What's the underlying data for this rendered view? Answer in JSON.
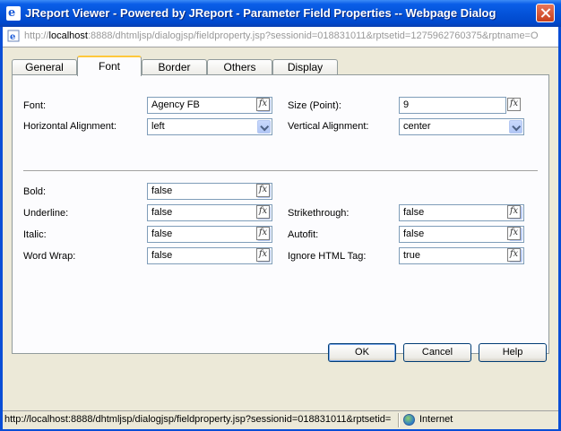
{
  "window": {
    "title": "JReport Viewer - Powered by JReport - Parameter Field Properties -- Webpage Dialog",
    "close_icon": "close-icon"
  },
  "address": {
    "prefix": "http://",
    "host": "localhost",
    "rest": ":8888/dhtmljsp/dialogjsp/fieldproperty.jsp?sessionid=018831011&rptsetid=1275962760375&rptname=O"
  },
  "tabs": [
    "General",
    "Font",
    "Border",
    "Others",
    "Display"
  ],
  "active_tab": "Font",
  "fields": {
    "font": {
      "label": "Font:",
      "value": "Agency FB"
    },
    "size": {
      "label": "Size (Point):",
      "value": "9"
    },
    "halign": {
      "label": "Horizontal Alignment:",
      "value": "left"
    },
    "valign": {
      "label": "Vertical Alignment:",
      "value": "center"
    },
    "bold": {
      "label": "Bold:",
      "value": "false"
    },
    "underline": {
      "label": "Underline:",
      "value": "false"
    },
    "strikethrough": {
      "label": "Strikethrough:",
      "value": "false"
    },
    "italic": {
      "label": "Italic:",
      "value": "false"
    },
    "autofit": {
      "label": "Autofit:",
      "value": "false"
    },
    "wordwrap": {
      "label": "Word Wrap:",
      "value": "false"
    },
    "ignorehtml": {
      "label": "Ignore HTML Tag:",
      "value": "true"
    }
  },
  "fx_label": "fx",
  "buttons": {
    "ok": "OK",
    "cancel": "Cancel",
    "help": "Help"
  },
  "status": {
    "url": "http://localhost:8888/dhtmljsp/dialogjsp/fieldproperty.jsp?sessionid=018831011&rptsetid=",
    "zone": "Internet"
  },
  "colors": {
    "titlebar": "#0453d9",
    "active_tab_accent": "#ffc83c",
    "label_purple": "#2c2c2c"
  }
}
